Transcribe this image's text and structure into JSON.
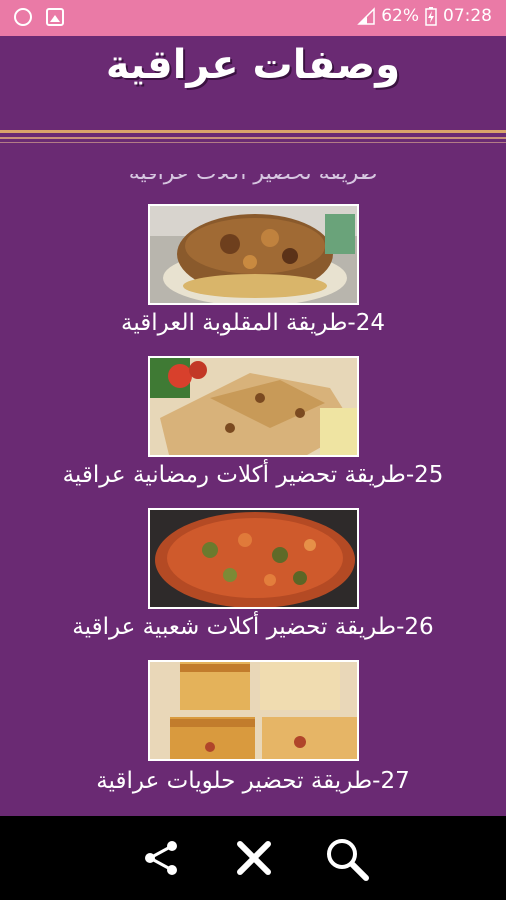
{
  "status_bar": {
    "battery": "62%",
    "time": "07:28"
  },
  "header": {
    "title": "وصفات عراقية"
  },
  "list": {
    "partial_caption": "طريقة تحضير أكلات عراقية",
    "items": [
      {
        "label": "24-طريقة المقلوبة العراقية",
        "image": "maqluba-photo"
      },
      {
        "label": "25-طريقة تحضير أكلات رمضانية عراقية",
        "image": "ramadan-pies-photo"
      },
      {
        "label": "26-طريقة تحضير أكلات شعبية عراقية",
        "image": "vegetable-casserole-photo"
      },
      {
        "label": "27-طريقة تحضير حلويات عراقية",
        "image": "dessert-squares-photo"
      }
    ]
  },
  "bottom_bar": {
    "icons": [
      "share-icon",
      "close-icon",
      "search-icon"
    ]
  },
  "colors": {
    "status_bar": "#ea7aa6",
    "background": "#6a2a73",
    "bottom_bar": "#000000"
  }
}
